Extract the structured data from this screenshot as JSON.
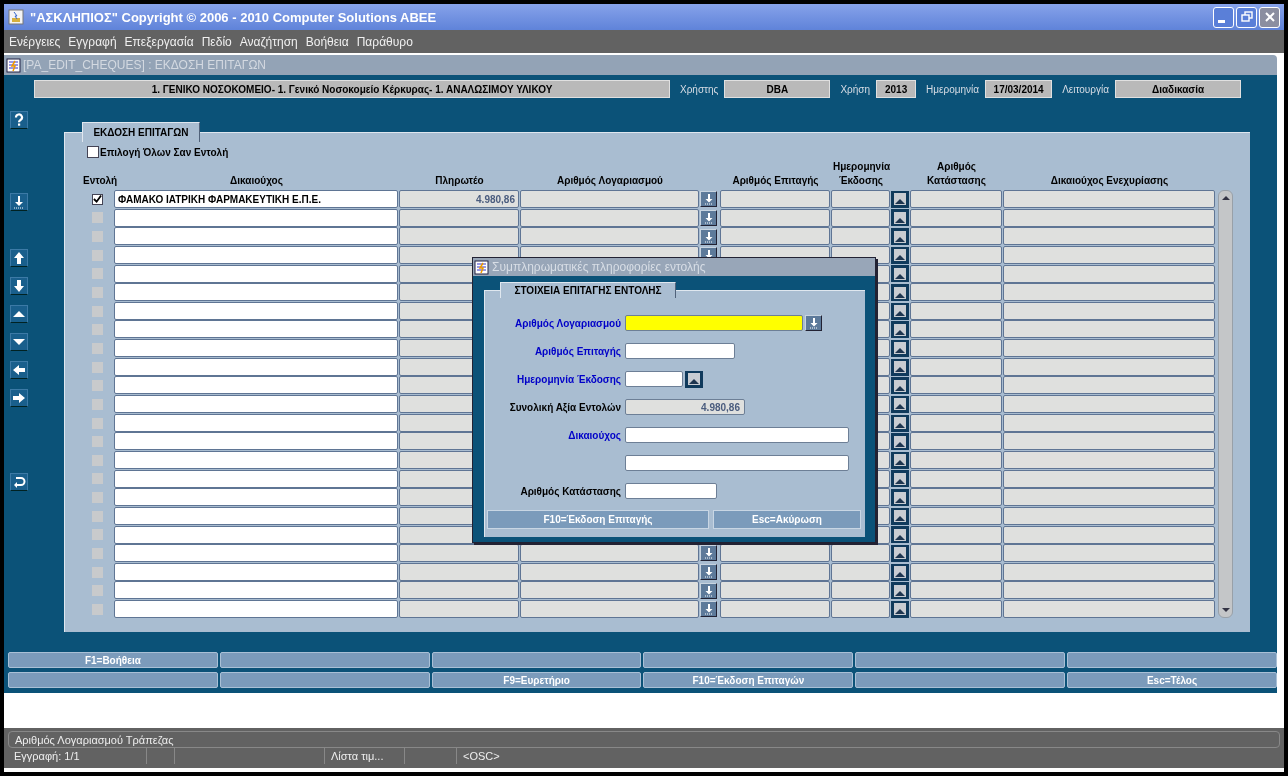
{
  "window": {
    "title": "\"ΑΣΚΛΗΠΙΟΣ\" Copyright © 2006 - 2010 Computer Solutions ABEE"
  },
  "menu": [
    "Ενέργειες",
    "Εγγραφή",
    "Επεξεργασία",
    "Πεδίο",
    "Αναζήτηση",
    "Βοήθεια",
    "Παράθυρο"
  ],
  "form": {
    "title": "[PA_EDIT_CHEQUES]   :   ΕΚΔΟΣΗ ΕΠΙΤΑΓΩΝ"
  },
  "header": {
    "organization": "1. ΓΕΝΙΚΟ ΝΟΣΟΚΟΜΕΙΟ- 1. Γενικό Νοσοκομείο Κέρκυρας- 1. ΑΝΑΛΩΣΙΜΟΥ ΥΛΙΚΟΥ",
    "fields": [
      {
        "label": "Χρήστης",
        "value": "DBA"
      },
      {
        "label": "Χρήση",
        "value": "2013"
      },
      {
        "label": "Ημερομηνία",
        "value": "17/03/2014"
      },
      {
        "label": "Λειτουργία",
        "value": "Διαδικασία"
      }
    ]
  },
  "panel": {
    "tab": "ΕΚΔΟΣΗ ΕΠΙΤΑΓΩΝ",
    "select_all": {
      "label": "Επιλογή Όλων Σαν  Εντολή",
      "checked": false
    },
    "columns": [
      "Εντολή",
      "Δικαιούχος",
      "Πληρωτέο",
      "Αριθμός Λογαριασμού",
      "Αριθμός Επιταγής",
      "Ημερομηνία Έκδοσης",
      "Αριθμός Κατάστασης",
      "Δικαιούχος Ενεχυρίασης"
    ],
    "rows": [
      {
        "checked": true,
        "disabled": false,
        "beneficiary": "ΦΑΜΑΚΟ ΙΑΤΡΙΚΗ ΦΑΡΜΑΚΕΥΤΙΚΗ Ε.Π.Ε.",
        "payable": "4.980,86"
      },
      {
        "checked": false,
        "disabled": true
      },
      {
        "checked": false,
        "disabled": true
      },
      {
        "checked": false,
        "disabled": true
      },
      {
        "checked": false,
        "disabled": true
      },
      {
        "checked": false,
        "disabled": true
      },
      {
        "checked": false,
        "disabled": true
      },
      {
        "checked": false,
        "disabled": true
      },
      {
        "checked": false,
        "disabled": true
      },
      {
        "checked": false,
        "disabled": true
      },
      {
        "checked": false,
        "disabled": true
      },
      {
        "checked": false,
        "disabled": true
      },
      {
        "checked": false,
        "disabled": true
      },
      {
        "checked": false,
        "disabled": true
      },
      {
        "checked": false,
        "disabled": true
      },
      {
        "checked": false,
        "disabled": true
      },
      {
        "checked": false,
        "disabled": true
      },
      {
        "checked": false,
        "disabled": true
      },
      {
        "checked": false,
        "disabled": true
      },
      {
        "checked": false,
        "disabled": true
      },
      {
        "checked": false,
        "disabled": true
      },
      {
        "checked": false,
        "disabled": true
      },
      {
        "checked": false,
        "disabled": true
      }
    ]
  },
  "function_keys": [
    [
      {
        "kind": "key",
        "label": "F1=Βοήθεια"
      },
      {
        "kind": "blank"
      },
      {
        "kind": "blank"
      },
      {
        "kind": "blank"
      },
      {
        "kind": "blank"
      },
      {
        "kind": "blank"
      }
    ],
    [
      {
        "kind": "blank"
      },
      {
        "kind": "blank"
      },
      {
        "kind": "key",
        "label": "F9=Ευρετήριο"
      },
      {
        "kind": "key",
        "label": "F10=Έκδοση Επιταγών"
      },
      {
        "kind": "blank"
      },
      {
        "kind": "key",
        "label": "Esc=Τέλος"
      }
    ]
  ],
  "dialog": {
    "title": "Συμπληρωματικές πληροφορίες εντολής",
    "tab": "ΣΤΟΙΧΕΙΑ ΕΠΙΤΑΓΗΣ ΕΝΤΟΛΗΣ",
    "fields": [
      {
        "label": "Αριθμός Λογαριασμού",
        "kind": "lov",
        "required": true,
        "focused": true
      },
      {
        "label": "Αριθμός Επιταγής",
        "kind": "text",
        "required": true,
        "focused": false
      },
      {
        "label": "Ημερομηνία Έκδοσης",
        "kind": "date",
        "required": true,
        "focused": false
      },
      {
        "label": "Συνολική Αξία Εντολών",
        "kind": "readonly",
        "required": false,
        "focused": false,
        "value": "4.980,86"
      },
      {
        "label": "Δικαιούχος",
        "kind": "wide",
        "required": true,
        "focused": false
      },
      {
        "kind": "wide",
        "focused": false
      },
      {
        "label": "Αριθμός Κατάστασης",
        "kind": "status",
        "required": false,
        "focused": false
      }
    ],
    "buttons": [
      "F10=Έκδοση Επιταγής",
      "Esc=Ακύρωση"
    ]
  },
  "status_bar": {
    "message": "Αριθμός Λογαριασμού Τράπεζας",
    "segments": [
      {
        "kind": "text",
        "text": "Εγγραφή: 1/1"
      },
      {
        "kind": "blank"
      },
      {
        "kind": "blank"
      },
      {
        "kind": "text",
        "text": "Λίστα τιμ..."
      },
      {
        "kind": "blank"
      },
      {
        "kind": "text",
        "text": "<OSC>"
      }
    ]
  }
}
